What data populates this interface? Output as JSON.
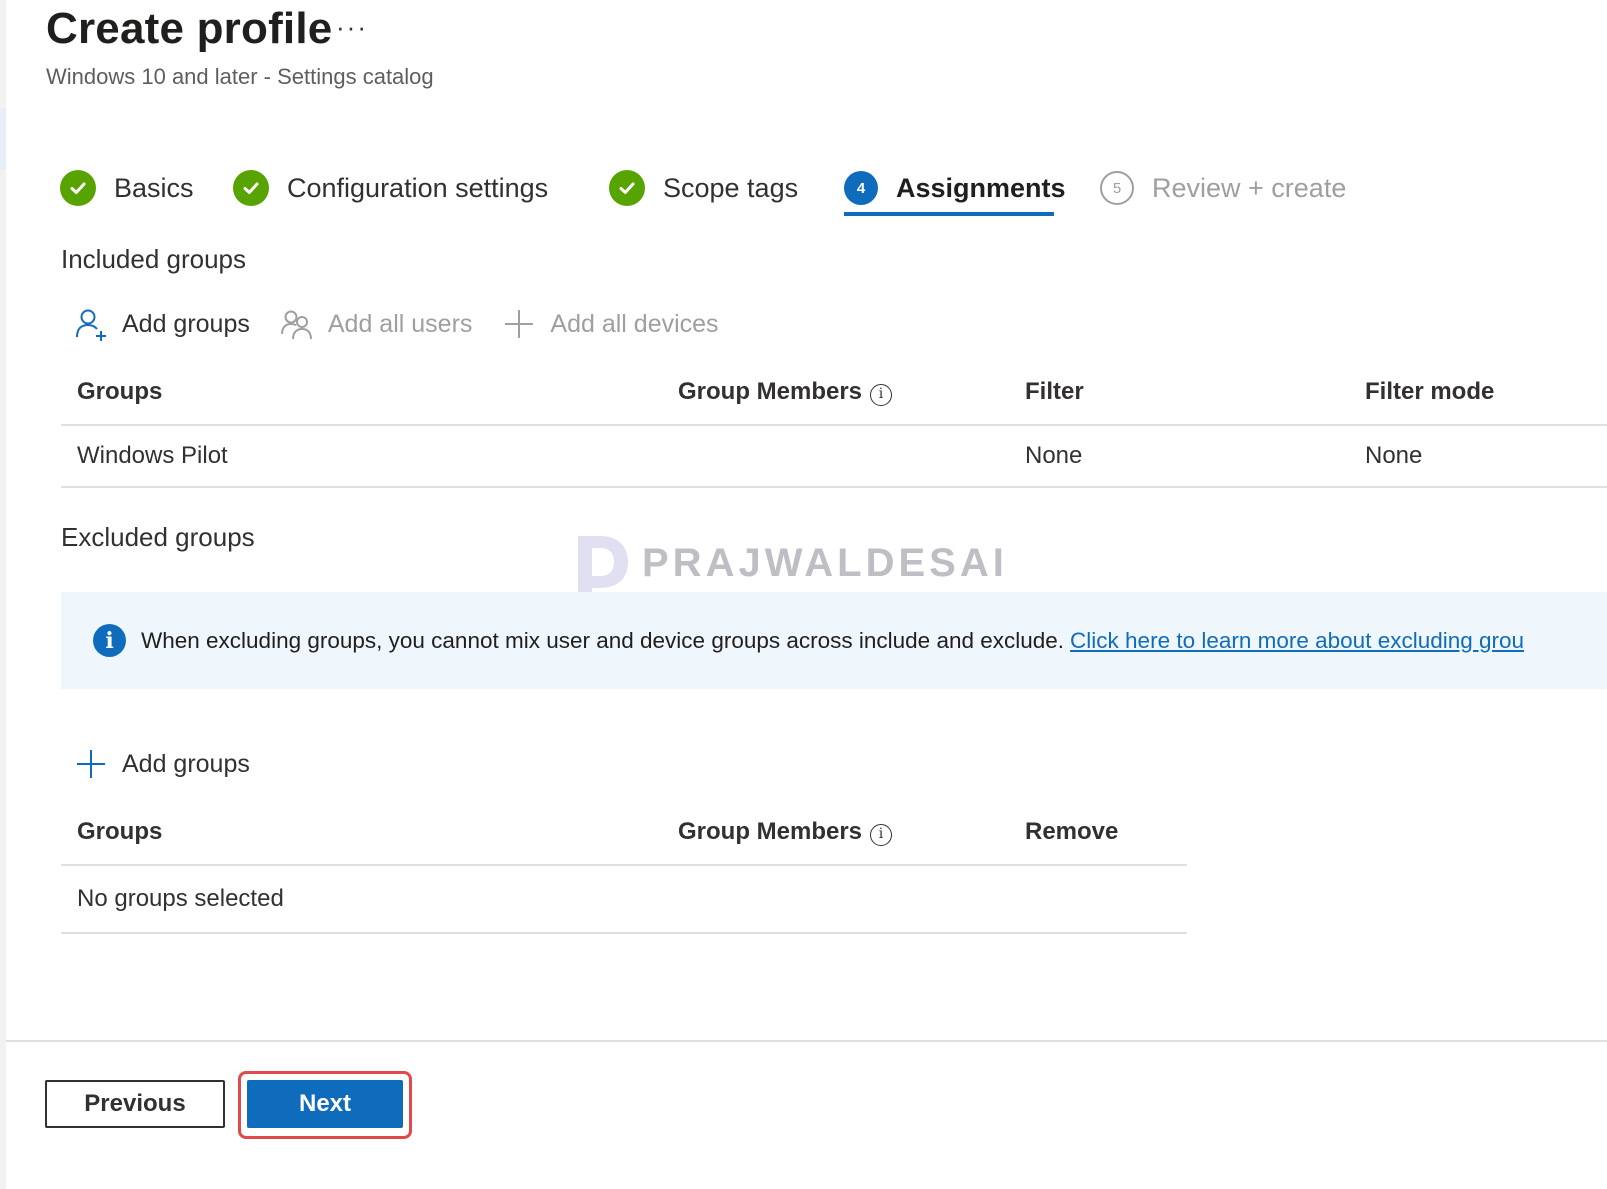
{
  "header": {
    "title": "Create profile",
    "more_label": "···",
    "subtitle": "Windows 10 and later - Settings catalog"
  },
  "steps": [
    {
      "label": "Basics",
      "state": "done"
    },
    {
      "label": "Configuration settings",
      "state": "done"
    },
    {
      "label": "Scope tags",
      "state": "done"
    },
    {
      "label": "Assignments",
      "state": "current",
      "number": "4"
    },
    {
      "label": "Review + create",
      "state": "todo",
      "number": "5"
    }
  ],
  "included": {
    "title": "Included groups",
    "commands": {
      "add_groups": "Add groups",
      "add_all_users": "Add all users",
      "add_all_devices": "Add all devices"
    },
    "columns": {
      "groups": "Groups",
      "group_members": "Group Members",
      "filter": "Filter",
      "filter_mode": "Filter mode"
    },
    "rows": [
      {
        "group": "Windows Pilot",
        "members": "",
        "filter": "None",
        "filter_mode": "None"
      }
    ]
  },
  "excluded": {
    "title": "Excluded groups",
    "info_text": "When excluding groups, you cannot mix user and device groups across include and exclude.",
    "info_link": "Click here to learn more about excluding grou",
    "add_groups": "Add groups",
    "columns": {
      "groups": "Groups",
      "group_members": "Group Members",
      "remove": "Remove"
    },
    "empty_text": "No groups selected"
  },
  "watermark": "PRAJWALDESAI",
  "footer": {
    "previous": "Previous",
    "next": "Next"
  },
  "colors": {
    "accent": "#0f6cbd",
    "success": "#57a300",
    "highlight": "#e04a4a",
    "info_bg": "#eff6fc"
  },
  "icons": {
    "step_done": "check-circle-icon",
    "add_groups": "add-person-icon",
    "add_all_users": "people-icon",
    "add_all_devices": "plus-icon",
    "info": "info-icon"
  }
}
